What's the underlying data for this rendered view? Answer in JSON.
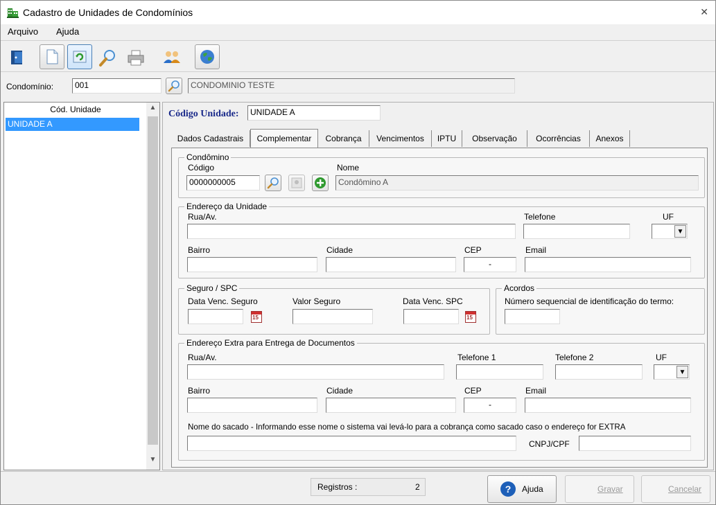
{
  "window": {
    "title": "Cadastro de Unidades de Condomínios"
  },
  "menu": {
    "items": [
      "Arquivo",
      "Ajuda"
    ]
  },
  "toolbar": {
    "icons": [
      "exit-door-icon",
      "new-document-icon",
      "refresh-icon",
      "search-icon",
      "print-icon",
      "users-icon",
      "globe-icon"
    ]
  },
  "condominio": {
    "label": "Condomínio:",
    "code": "001",
    "name": "CONDOMINIO TESTE"
  },
  "list": {
    "header": "Cód. Unidade",
    "rows": [
      "UNIDADE A"
    ]
  },
  "unit": {
    "label": "Código Unidade:",
    "value": "UNIDADE A"
  },
  "tabs": [
    "Dados Cadastrais",
    "Complementar",
    "Cobrança",
    "Vencimentos",
    "IPTU",
    "Observação",
    "Ocorrências",
    "Anexos"
  ],
  "condomino": {
    "title": "Condômino",
    "code_label": "Código",
    "code": "0000000005",
    "name_label": "Nome",
    "name": "Condômino A"
  },
  "endereco": {
    "title": "Endereço da Unidade",
    "rua": "Rua/Av.",
    "telefone": "Telefone",
    "uf": "UF",
    "bairro": "Bairro",
    "cidade": "Cidade",
    "cep": "CEP",
    "cep_mask": "-",
    "email": "Email"
  },
  "seguro": {
    "title": "Seguro / SPC",
    "venc_seguro": "Data Venc. Seguro",
    "valor_seguro": "Valor Seguro",
    "venc_spc": "Data Venc. SPC",
    "cal_day": "15"
  },
  "acordos": {
    "title": "Acordos",
    "seq_label": "Número sequencial de identificação do termo:"
  },
  "extra": {
    "title": "Endereço Extra para  Entrega de Documentos",
    "rua": "Rua/Av.",
    "telefone1": "Telefone 1",
    "telefone2": "Telefone 2",
    "uf": "UF",
    "bairro": "Bairro",
    "cidade": "Cidade",
    "cep": "CEP",
    "cep_mask": "-",
    "email": "Email",
    "sacado_label": "Nome do sacado - Informando esse nome o sistema vai levá-lo para a cobrança como sacado caso o endereço for EXTRA",
    "cnpj_label": "CNPJ/CPF"
  },
  "status": {
    "registros_label": "Registros :",
    "registros_value": "2"
  },
  "buttons": {
    "ajuda": "Ajuda",
    "gravar": "Gravar",
    "cancelar": "Cancelar"
  },
  "colors": {
    "selection": "#3399ff",
    "unit_label": "#1a2a8a"
  }
}
